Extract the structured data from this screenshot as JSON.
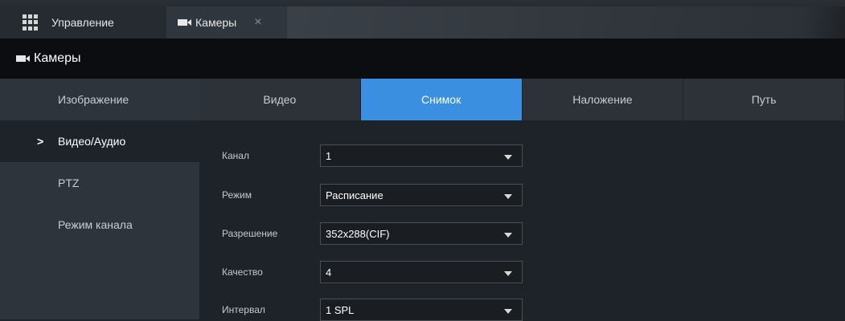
{
  "topbar": {
    "manage_label": "Управление",
    "cameras_tab_label": "Камеры",
    "close_symbol": "×"
  },
  "header": {
    "title": "Камеры"
  },
  "sidebar": {
    "items": [
      {
        "label": "Изображение"
      },
      {
        "label": "Видео/Аудио",
        "active": true
      },
      {
        "label": "PTZ"
      },
      {
        "label": "Режим канала"
      }
    ],
    "active_marker": ">"
  },
  "tabs": [
    {
      "label": "Видео"
    },
    {
      "label": "Снимок",
      "active": true
    },
    {
      "label": "Наложение"
    },
    {
      "label": "Путь"
    }
  ],
  "form": {
    "fields": [
      {
        "label": "Канал",
        "value": "1"
      },
      {
        "label": "Режим",
        "value": "Расписание"
      },
      {
        "label": "Разрешение",
        "value": "352x288(CIF)"
      },
      {
        "label": "Качество",
        "value": "4"
      },
      {
        "label": "Интервал",
        "value": "1 SPL"
      }
    ]
  },
  "colors": {
    "accent": "#3b8fe0",
    "header_bg": "#0b0d10",
    "sidebar_bg": "#2e343b",
    "main_bg": "#1e2329"
  },
  "icons": {
    "menu": "grid-icon",
    "camera": "camera-icon",
    "close": "close-icon",
    "dropdown": "chevron-down-icon"
  }
}
